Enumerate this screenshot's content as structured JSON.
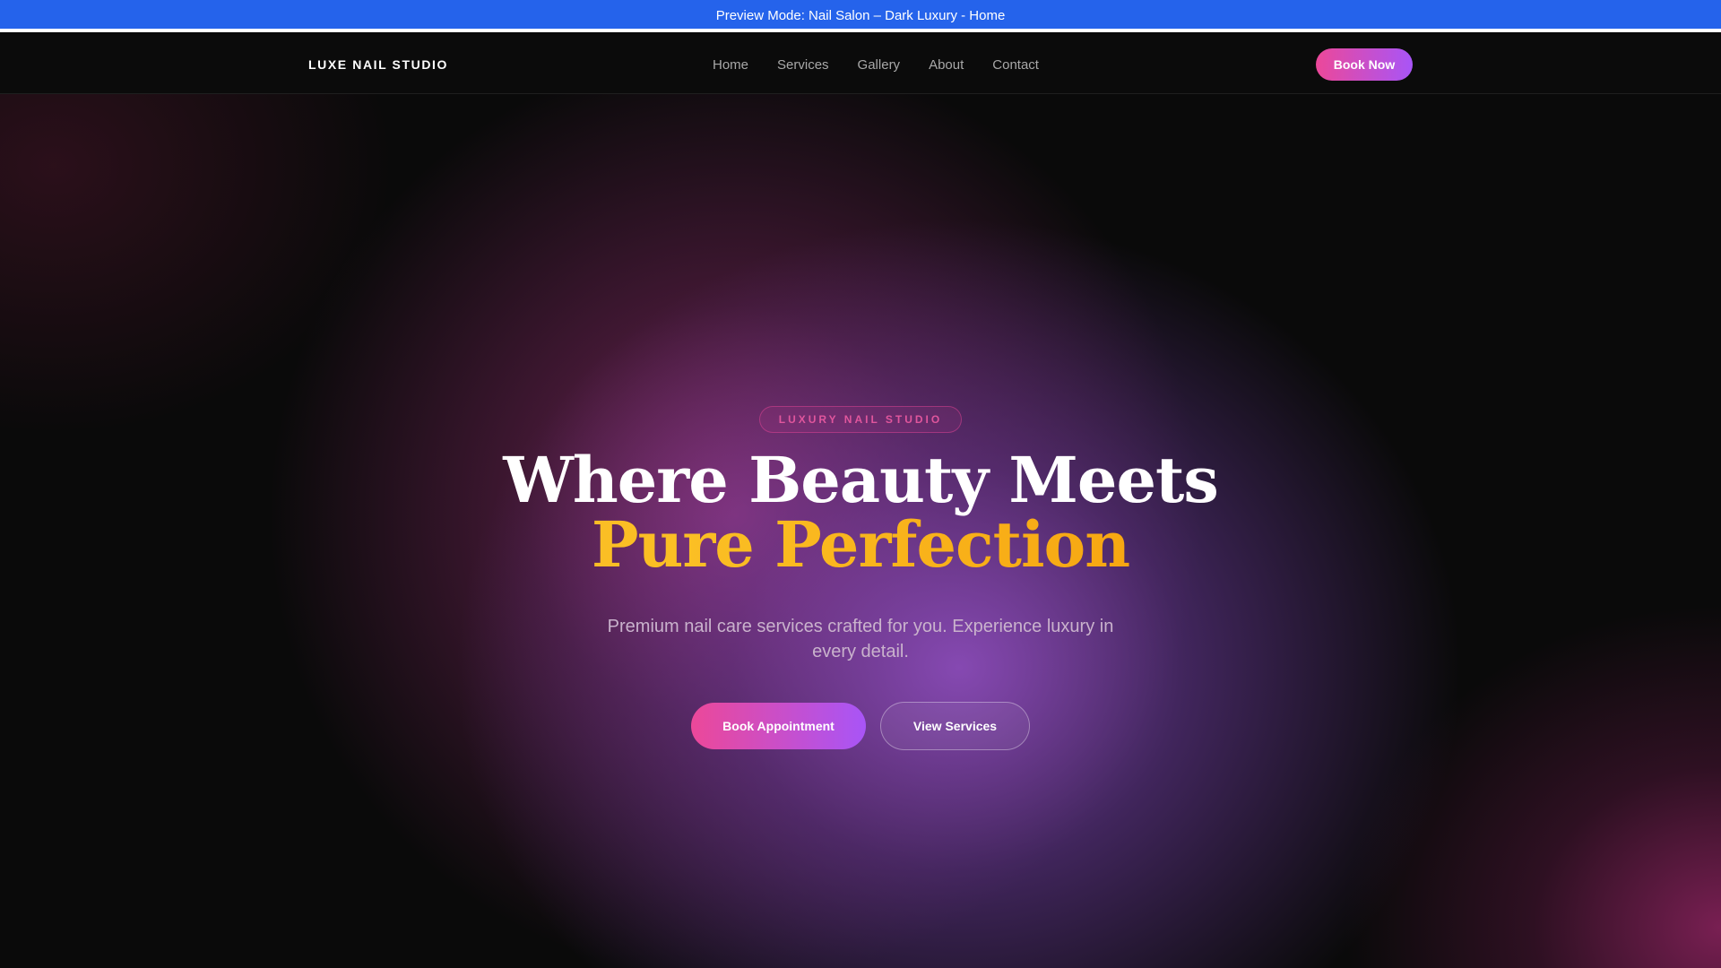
{
  "preview_bar": {
    "text": "Preview Mode: Nail Salon – Dark Luxury - Home"
  },
  "nav": {
    "brand": "LUXE NAIL STUDIO",
    "links": [
      {
        "label": "Home"
      },
      {
        "label": "Services"
      },
      {
        "label": "Gallery"
      },
      {
        "label": "About"
      },
      {
        "label": "Contact"
      }
    ],
    "cta_label": "Book Now"
  },
  "hero": {
    "badge": "LUXURY NAIL STUDIO",
    "headline_line1": "Where Beauty Meets",
    "headline_line2": "Pure Perfection",
    "subtitle": "Premium nail care services crafted for you. Experience luxury in every detail.",
    "primary_button": "Book Appointment",
    "secondary_button": "View Services"
  },
  "colors": {
    "preview_bar": "#2563eb",
    "background": "#0a0a0a",
    "accent_pink": "#ec4899",
    "accent_purple": "#a855f7",
    "accent_gold": "#fbbf24"
  }
}
